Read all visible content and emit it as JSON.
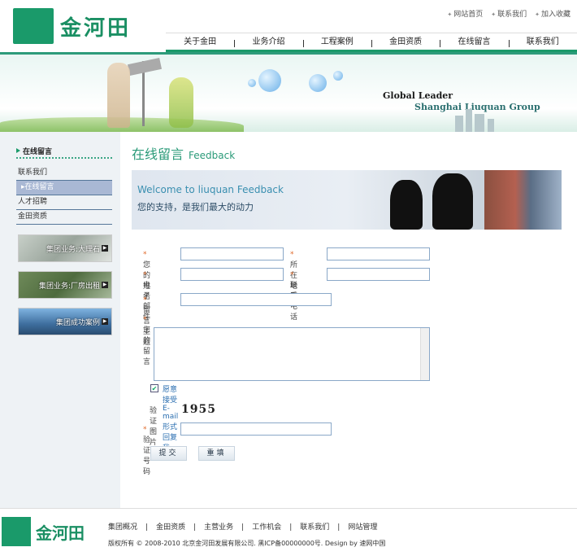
{
  "header": {
    "logo_text": "金河田",
    "top_links": [
      "网站首页",
      "联系我们",
      "加入收藏"
    ],
    "nav": [
      "关于金田",
      "业务介绍",
      "工程案例",
      "金田资质",
      "在线留言",
      "联系我们"
    ]
  },
  "banner": {
    "title": "Global Leader",
    "subtitle": "Shanghai Liuquan Group"
  },
  "sidebar": {
    "heading": "在线留言",
    "items": [
      {
        "label": "联系我们",
        "active": false
      },
      {
        "label": "在线留言",
        "active": true
      },
      {
        "label": "人才招聘",
        "active": false
      },
      {
        "label": "金田资质",
        "active": false
      }
    ],
    "promos": [
      "集团业务:大理石",
      "集团业务:厂房出租",
      "集团成功案例"
    ]
  },
  "main": {
    "title_cn": "在线留言",
    "title_en": "Feedback",
    "welcome_en": "Welcome to liuquan Feedback",
    "welcome_cn": "您的支持，是我们最大的动力"
  },
  "form": {
    "name_label": "您的姓名",
    "region_label": "所在地区",
    "email_label": "电子邮件",
    "phone_label": "联系电话",
    "subject_label": "留言主题",
    "message_label": "您的留言",
    "reply_label": "愿意接受E-mail形式回复我",
    "reply_checked": true,
    "captcha_label": "验证图片",
    "captcha_text": "1955",
    "code_label": "验证号码",
    "submit_label": "提交",
    "reset_label": "重填"
  },
  "footer": {
    "logo_text": "金河田",
    "links": [
      "集团概况",
      "金田资质",
      "主营业务",
      "工作机会",
      "联系我们",
      "网站管理"
    ],
    "copyright": "版权所有 © 2008-2010 北京金河田发展有限公司. 黑ICP备00000000号. Design by 速网中国"
  }
}
